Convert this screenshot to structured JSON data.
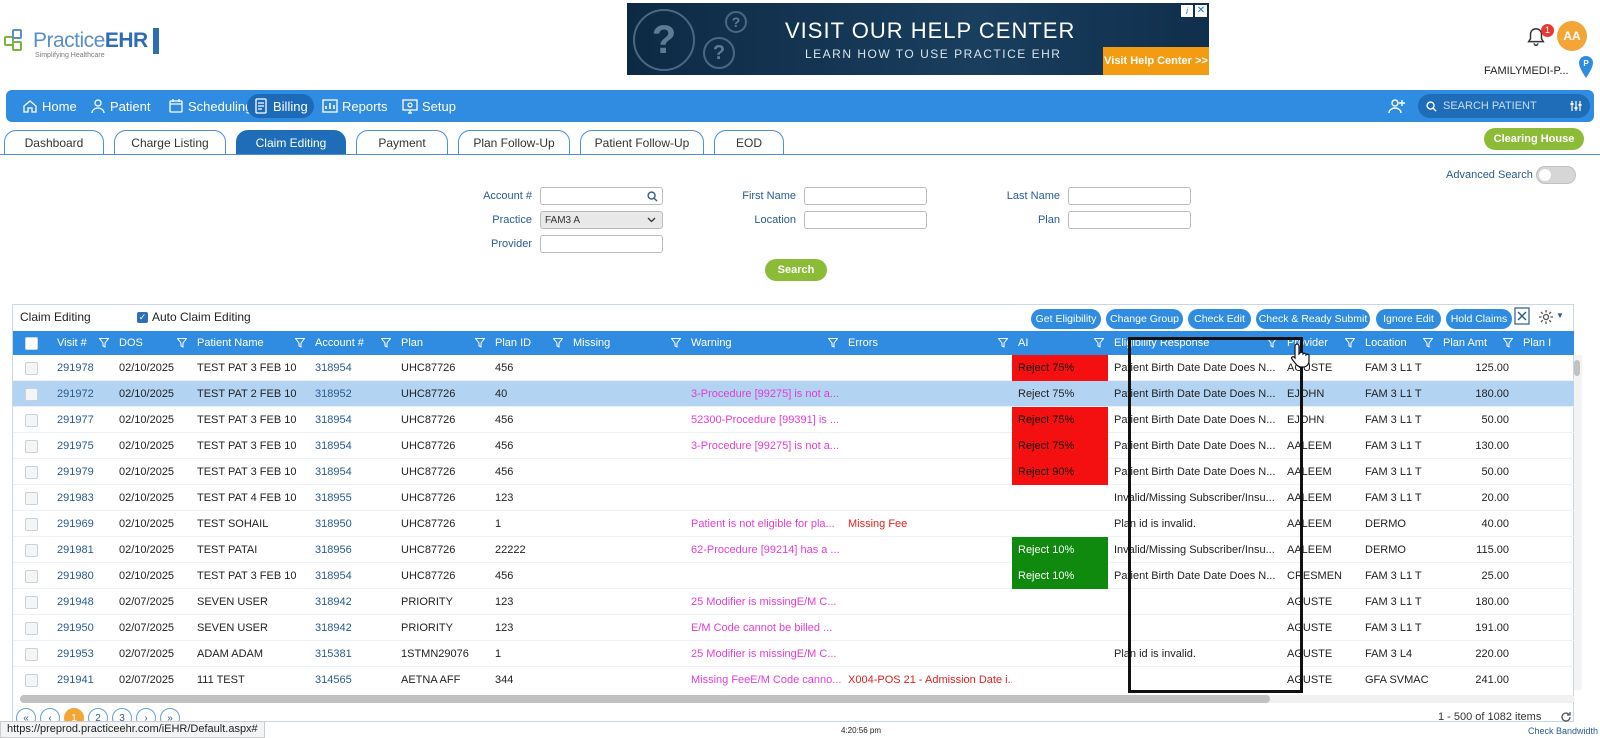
{
  "brand": {
    "name_light": "Practice",
    "name_bold": "EHR",
    "tagline": "Simplifying Healthcare"
  },
  "banner": {
    "title": "VISIT OUR HELP CENTER",
    "subtitle": "LEARN HOW TO USE PRACTICE EHR",
    "cta": "Visit Help Center >>",
    "close": "✕",
    "info": "i"
  },
  "header": {
    "notif_count": "1",
    "avatar": "AA",
    "practice_name": "FAMILYMEDI-P..."
  },
  "nav": {
    "items": [
      {
        "label": "Home",
        "icon": "home-icon"
      },
      {
        "label": "Patient",
        "icon": "user-icon"
      },
      {
        "label": "Scheduling",
        "icon": "calendar-icon"
      },
      {
        "label": "Billing",
        "icon": "invoice-icon"
      },
      {
        "label": "Reports",
        "icon": "chart-icon"
      },
      {
        "label": "Setup",
        "icon": "monitor-gear-icon"
      }
    ],
    "search_placeholder": "SEARCH PATIENT"
  },
  "tabs": [
    "Dashboard",
    "Charge Listing",
    "Claim Editing",
    "Payment",
    "Plan Follow-Up",
    "Patient Follow-Up",
    "EOD"
  ],
  "clearing_house": "Clearing House",
  "form": {
    "account_label": "Account #",
    "practice_label": "Practice",
    "practice_value": "FAM3 A",
    "provider_label": "Provider",
    "first_name_label": "First Name",
    "location_label": "Location",
    "last_name_label": "Last Name",
    "plan_label": "Plan",
    "search_button": "Search",
    "advanced_search": "Advanced Search"
  },
  "grid": {
    "title": "Claim Editing",
    "auto_label": "Auto Claim Editing",
    "actions": [
      "Get Eligibility",
      "Change Group",
      "Check Edit",
      "Check & Ready Submit",
      "Ignore Edit",
      "Hold Claims"
    ],
    "columns": [
      "Visit #",
      "DOS",
      "Patient Name",
      "Account #",
      "Plan",
      "Plan ID",
      "Missing",
      "Warning",
      "Errors",
      "AI",
      "Eligibility Response",
      "Provider",
      "Location",
      "Plan Amt",
      "Plan I"
    ],
    "rows": [
      {
        "visit": "291978",
        "dos": "02/10/2025",
        "patient": "TEST PAT 3 FEB 10",
        "account": "318954",
        "plan": "UHC87726",
        "plan_id": "456",
        "missing": "",
        "warning": "",
        "errors": "",
        "ai": "Reject 75%",
        "ai_style": "red",
        "elig": "Patient Birth Date Date Does N...",
        "provider": "AGUSTE",
        "location": "FAM 3 L1 T",
        "amt": "125.00"
      },
      {
        "visit": "291972",
        "dos": "02/10/2025",
        "patient": "TEST PAT 2 FEB 10",
        "account": "318952",
        "plan": "UHC87726",
        "plan_id": "40",
        "missing": "",
        "warning": "3-Procedure [99275] is not a...",
        "errors": "",
        "ai": "Reject 75%",
        "ai_style": "none",
        "elig": "Patient Birth Date Date Does N...",
        "provider": "EJOHN",
        "location": "FAM 3 L1 T",
        "amt": "180.00",
        "selected": true
      },
      {
        "visit": "291977",
        "dos": "02/10/2025",
        "patient": "TEST PAT 3 FEB 10",
        "account": "318954",
        "plan": "UHC87726",
        "plan_id": "456",
        "missing": "",
        "warning": "52300-Procedure [99391] is ...",
        "errors": "",
        "ai": "Reject 75%",
        "ai_style": "red",
        "elig": "Patient Birth Date Date Does N...",
        "provider": "EJOHN",
        "location": "FAM 3 L1 T",
        "amt": "50.00"
      },
      {
        "visit": "291975",
        "dos": "02/10/2025",
        "patient": "TEST PAT 3 FEB 10",
        "account": "318954",
        "plan": "UHC87726",
        "plan_id": "456",
        "missing": "",
        "warning": "3-Procedure [99275] is not a...",
        "errors": "",
        "ai": "Reject 75%",
        "ai_style": "red",
        "elig": "Patient Birth Date Date Does N...",
        "provider": "AALEEM",
        "location": "FAM 3 L1 T",
        "amt": "130.00"
      },
      {
        "visit": "291979",
        "dos": "02/10/2025",
        "patient": "TEST PAT 3 FEB 10",
        "account": "318954",
        "plan": "UHC87726",
        "plan_id": "456",
        "missing": "",
        "warning": "",
        "errors": "",
        "ai": "Reject 90%",
        "ai_style": "red",
        "elig": "Patient Birth Date Date Does N...",
        "provider": "AALEEM",
        "location": "FAM 3 L1 T",
        "amt": "50.00"
      },
      {
        "visit": "291983",
        "dos": "02/10/2025",
        "patient": "TEST PAT 4 FEB 10",
        "account": "318955",
        "plan": "UHC87726",
        "plan_id": "123",
        "missing": "",
        "warning": "",
        "errors": "",
        "ai": "",
        "ai_style": "none",
        "elig": "Invalid/Missing Subscriber/Insu...",
        "provider": "AALEEM",
        "location": "FAM 3 L1 T",
        "amt": "20.00"
      },
      {
        "visit": "291969",
        "dos": "02/10/2025",
        "patient": "TEST SOHAIL",
        "account": "318950",
        "plan": "UHC87726",
        "plan_id": "1",
        "missing": "",
        "warning": "Patient is not eligible for pla...",
        "errors": "Missing Fee",
        "ai": "",
        "ai_style": "none",
        "elig": "Plan id is invalid.",
        "provider": "AALEEM",
        "location": "DERMO",
        "amt": "40.00"
      },
      {
        "visit": "291981",
        "dos": "02/10/2025",
        "patient": "TEST PATAI",
        "account": "318956",
        "plan": "UHC87726",
        "plan_id": "22222",
        "missing": "",
        "warning": "62-Procedure [99214] has a ...",
        "errors": "",
        "ai": "Reject 10%",
        "ai_style": "green",
        "elig": "Invalid/Missing Subscriber/Insu...",
        "provider": "AALEEM",
        "location": "DERMO",
        "amt": "115.00"
      },
      {
        "visit": "291980",
        "dos": "02/10/2025",
        "patient": "TEST PAT 3 FEB 10",
        "account": "318954",
        "plan": "UHC87726",
        "plan_id": "456",
        "missing": "",
        "warning": "",
        "errors": "",
        "ai": "Reject 10%",
        "ai_style": "green",
        "elig": "Patient Birth Date Date Does N...",
        "provider": "CRESMEN",
        "location": "FAM 3 L1 T",
        "amt": "25.00"
      },
      {
        "visit": "291948",
        "dos": "02/07/2025",
        "patient": "SEVEN USER",
        "account": "318942",
        "plan": "PRIORITY",
        "plan_id": "123",
        "missing": "",
        "warning": "25 Modifier is missingE/M C...",
        "errors": "",
        "ai": "",
        "ai_style": "none",
        "elig": "",
        "provider": "AGUSTE",
        "location": "FAM 3 L1 T",
        "amt": "180.00"
      },
      {
        "visit": "291950",
        "dos": "02/07/2025",
        "patient": "SEVEN USER",
        "account": "318942",
        "plan": "PRIORITY",
        "plan_id": "123",
        "missing": "",
        "warning": "E/M Code cannot be billed ...",
        "errors": "",
        "ai": "",
        "ai_style": "none",
        "elig": "",
        "provider": "AGUSTE",
        "location": "FAM 3 L1 T",
        "amt": "191.00"
      },
      {
        "visit": "291953",
        "dos": "02/07/2025",
        "patient": "ADAM ADAM",
        "account": "315381",
        "plan": "1STMN29076",
        "plan_id": "1",
        "missing": "",
        "warning": "25 Modifier is missingE/M C...",
        "errors": "",
        "ai": "",
        "ai_style": "none",
        "elig": "Plan id is invalid.",
        "provider": "AGUSTE",
        "location": "FAM 3 L4",
        "amt": "220.00"
      },
      {
        "visit": "291941",
        "dos": "02/07/2025",
        "patient": "111 TEST",
        "account": "314565",
        "plan": "AETNA AFF",
        "plan_id": "344",
        "missing": "",
        "warning": "Missing FeeE/M Code canno...",
        "errors": "X004-POS 21 - Admission Date i...",
        "ai": "",
        "ai_style": "none",
        "elig": "",
        "provider": "AGUSTE",
        "location": "GFA SVMAC",
        "amt": "241.00"
      }
    ],
    "items_label": "1 - 500 of 1082 items",
    "pages": [
      "«",
      "‹",
      "1",
      "2",
      "3",
      "›",
      "»"
    ]
  },
  "status": {
    "url": "https://preprod.practiceehr.com/iEHR/Default.aspx#",
    "clock": "4:20:56 pm",
    "bandwidth": "Check Bandwidth"
  },
  "colors": {
    "nav_blue": "#2f8ce0",
    "green": "#8cbb38",
    "reject_red": "#f41010",
    "reject_green": "#0f8a0f",
    "warning_pink": "#e23dd4"
  }
}
